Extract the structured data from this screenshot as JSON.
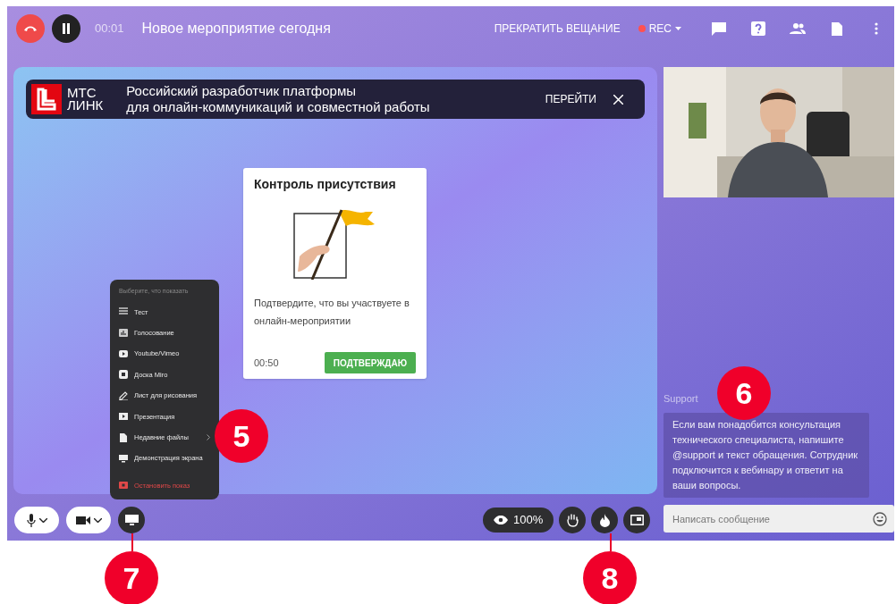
{
  "top_bar": {
    "time": "00:01",
    "title": "Новое мероприятие сегодня",
    "stop_broadcast": "ПРЕКРАТИТЬ ВЕЩАНИЕ",
    "rec": "REC"
  },
  "banner": {
    "logo_line1": "МТС",
    "logo_line2": "ЛИНК",
    "text_line1": "Российский разработчик платформы",
    "text_line2": "для онлайн-коммуникаций и совместной работы",
    "action": "ПЕРЕЙТИ"
  },
  "attendance_card": {
    "title": "Контроль присутствия",
    "message": "Подтвердите, что вы участвуете в онлайн-мероприятии",
    "timer": "00:50",
    "confirm": "ПОДТВЕРЖДАЮ"
  },
  "show_menu": {
    "heading": "Выберите, что показать",
    "items": [
      {
        "kind": "list",
        "label": "Тест",
        "submenu": false
      },
      {
        "kind": "poll",
        "label": "Голосование",
        "submenu": false
      },
      {
        "kind": "video",
        "label": "Youtube/Vimeo",
        "submenu": false
      },
      {
        "kind": "board",
        "label": "Доска Miro",
        "submenu": false
      },
      {
        "kind": "pen",
        "label": "Лист для рисования",
        "submenu": false
      },
      {
        "kind": "slides",
        "label": "Презентация",
        "submenu": false
      },
      {
        "kind": "file",
        "label": "Недавние файлы",
        "submenu": true
      },
      {
        "kind": "screen",
        "label": "Демонстрация экрана",
        "submenu": false
      },
      {
        "kind": "stop",
        "label": "Остановить показ",
        "submenu": false
      }
    ]
  },
  "chat": {
    "author": "Support",
    "message": "Если вам понадобится консультация технического специалиста, напишите @support и текст обращения. Сотрудник подключится к вебинару и ответит на ваши вопросы.",
    "placeholder": "Написать сообщение"
  },
  "bottom_bar": {
    "zoom": "100%"
  },
  "callouts": [
    {
      "number": "5"
    },
    {
      "number": "6"
    },
    {
      "number": "7"
    },
    {
      "number": "8"
    }
  ]
}
